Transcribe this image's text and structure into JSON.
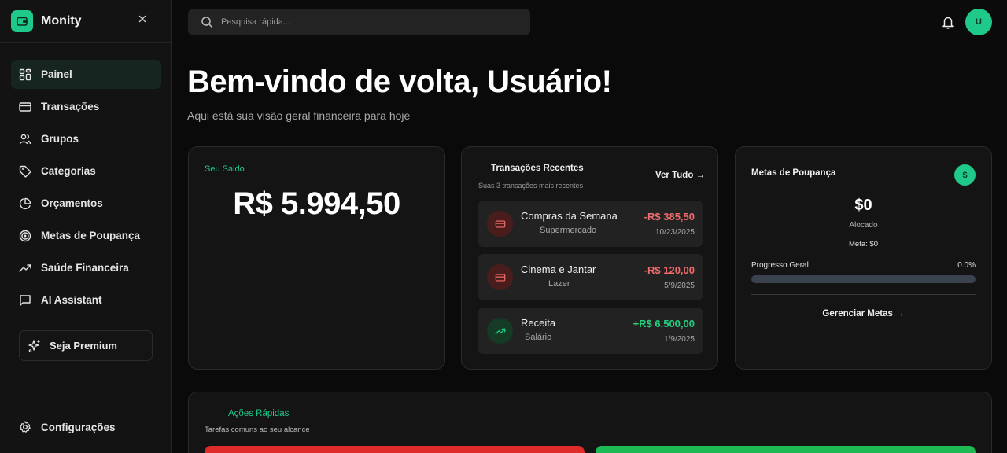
{
  "app": {
    "name": "Monity",
    "close_icon": "close-icon"
  },
  "colors": {
    "accent": "#1ec98a",
    "expense": "#f06b6b",
    "income": "#22d07e",
    "background": "#0a0a0a",
    "quick_action_red": "#e02b2b",
    "quick_action_green": "#1db954"
  },
  "sidebar": {
    "items": [
      {
        "label": "Painel",
        "icon": "grid-icon",
        "active": true
      },
      {
        "label": "Transações",
        "icon": "credit-card-icon",
        "active": false
      },
      {
        "label": "Grupos",
        "icon": "users-icon",
        "active": false
      },
      {
        "label": "Categorias",
        "icon": "tag-icon",
        "active": false
      },
      {
        "label": "Orçamentos",
        "icon": "pie-chart-icon",
        "active": false
      },
      {
        "label": "Metas de Poupança",
        "icon": "target-icon",
        "active": false
      },
      {
        "label": "Saúde Financeira",
        "icon": "trending-up-icon",
        "active": false
      },
      {
        "label": "AI Assistant",
        "icon": "message-square-icon",
        "active": false
      }
    ],
    "premium_label": "Seja Premium",
    "settings_label": "Configurações"
  },
  "topbar": {
    "search_placeholder": "Pesquisa rápida...",
    "avatar_initial": "U"
  },
  "header": {
    "title": "Bem-vindo de volta, Usuário!",
    "subtitle": "Aqui está sua visão geral financeira para hoje"
  },
  "balance": {
    "label": "Seu Saldo",
    "value": "R$ 5.994,50"
  },
  "recent": {
    "title": "Transações Recentes",
    "subtitle": "Suas 3 transações mais recentes",
    "link": "Ver Tudo →",
    "items": [
      {
        "name": "Compras da Semana",
        "category": "Supermercado",
        "amount": "-R$ 385,50",
        "date": "10/23/2025",
        "type": "expense"
      },
      {
        "name": "Cinema e Jantar",
        "category": "Lazer",
        "amount": "-R$ 120,00",
        "date": "5/9/2025",
        "type": "expense"
      },
      {
        "name": "Receita",
        "category": "Salário",
        "amount": "+R$ 6.500,00",
        "date": "1/9/2025",
        "type": "income"
      }
    ]
  },
  "goals": {
    "title": "Metas de Poupança",
    "badge": "$",
    "amount": "$0",
    "allocated_label": "Alocado",
    "target": "Meta: $0",
    "progress_label": "Progresso Geral",
    "progress_pct": "0.0%",
    "progress_fraction": 0,
    "link": "Gerenciar Metas →"
  },
  "quick_actions": {
    "title": "Ações Rápidas",
    "subtitle": "Tarefas comuns ao seu alcance"
  }
}
